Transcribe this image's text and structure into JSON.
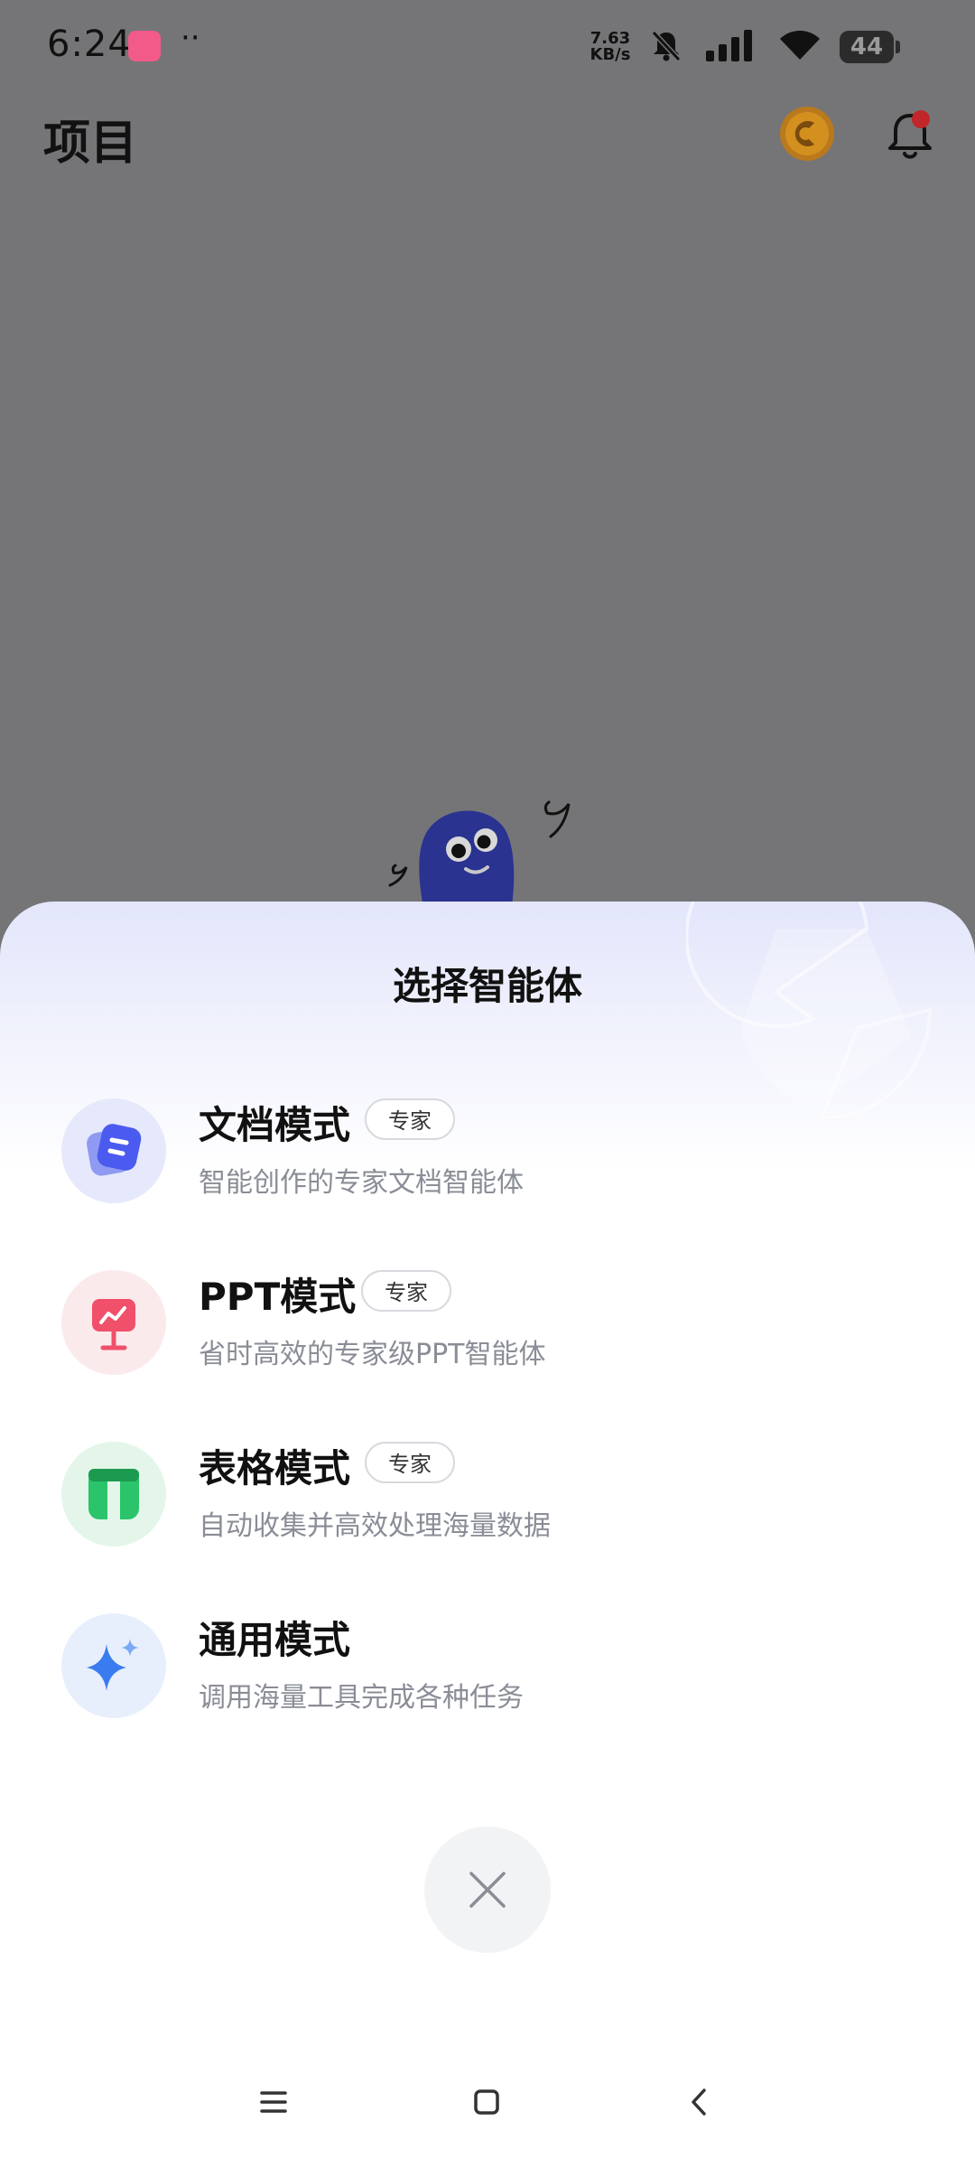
{
  "status_bar": {
    "time": "6:24",
    "dots": "··",
    "net_speed_value": "7.63",
    "net_speed_unit": "KB/s",
    "battery": "44"
  },
  "header": {
    "title": "项目"
  },
  "sheet": {
    "title": "选择智能体",
    "modes": [
      {
        "name": "文档模式",
        "badge": "专家",
        "desc": "智能创作的专家文档智能体",
        "icon": "document-icon",
        "color": "#4b5bf0"
      },
      {
        "name": "PPT模式",
        "badge": "专家",
        "desc": "省时高效的专家级PPT智能体",
        "icon": "presentation-icon",
        "color": "#f0506a"
      },
      {
        "name": "表格模式",
        "badge": "专家",
        "desc": "自动收集并高效处理海量数据",
        "icon": "table-icon",
        "color": "#2bc46a"
      },
      {
        "name": "通用模式",
        "badge": "",
        "desc": "调用海量工具完成各种任务",
        "icon": "sparkle-icon",
        "color": "#3a7cf0"
      }
    ]
  },
  "colors": {
    "backdrop": "#757577",
    "sheet_top": "#e3e6fb",
    "mascot": "#2a3390"
  }
}
